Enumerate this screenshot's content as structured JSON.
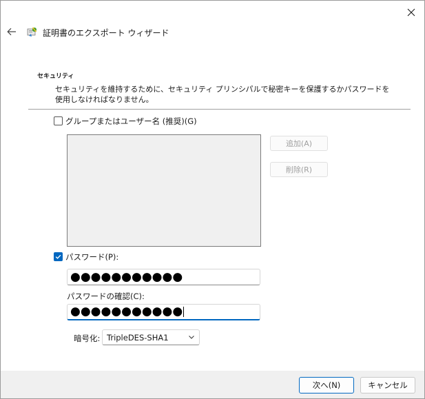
{
  "window": {
    "title": "証明書のエクスポート ウィザード"
  },
  "section": {
    "title": "セキュリティ",
    "description": "セキュリティを維持するために、セキュリティ プリンシパルで秘密キーを保護するかパスワードを使用しなければなりません。"
  },
  "group_option": {
    "label": "グループまたはユーザー名 (推奨)(G)",
    "checked": false
  },
  "side_buttons": {
    "add": "追加(A)",
    "remove": "削除(R)"
  },
  "password_option": {
    "label": "パスワード(P):",
    "checked": true
  },
  "password": {
    "masked": "●●●●●●●●●●●"
  },
  "confirm": {
    "label": "パスワードの確認(C):",
    "masked": "●●●●●●●●●●●"
  },
  "encryption": {
    "label": "暗号化:",
    "selected": "TripleDES-SHA1"
  },
  "footer": {
    "next": "次へ(N)",
    "cancel": "キャンセル"
  },
  "colors": {
    "accent": "#0067c0",
    "footer_bg": "#f0f0f0",
    "list_bg": "#f0f0f0"
  },
  "icons": {
    "close": "close-icon",
    "back": "back-arrow-icon",
    "wizard": "certificate-wizard-icon",
    "check": "checkmark-icon",
    "dropdown": "chevron-down-icon"
  }
}
